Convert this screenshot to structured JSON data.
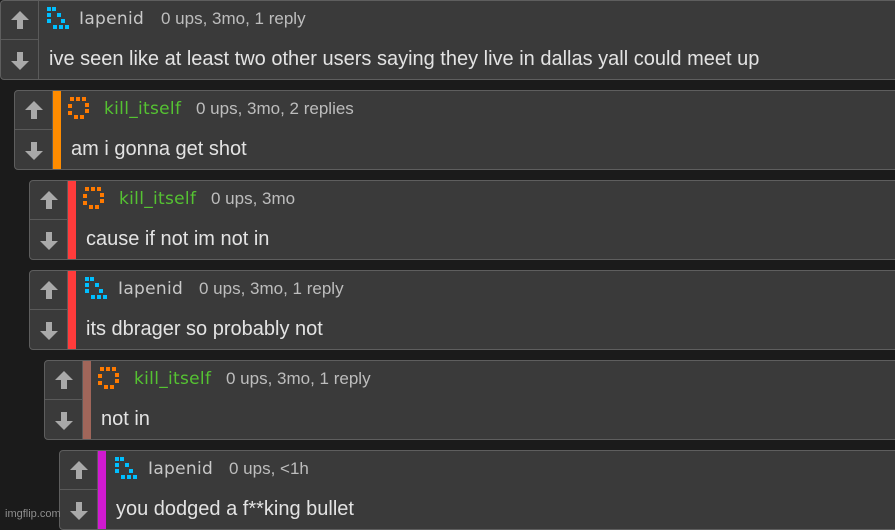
{
  "colors": {
    "user_blue": "#00bfff",
    "user_orange": "#ff7a00",
    "username_gray": "#c8c8c8",
    "username_green": "#55c232",
    "depth_bars": [
      "#ff8c00",
      "#ff3b3b",
      "#ff3b3b",
      "#a0665a",
      "#d11ad1"
    ]
  },
  "comments": [
    {
      "username": "Iapenid",
      "meta": "0 ups, 3mo, 1 reply",
      "text": "ive seen like at least two other users saying they live in dallas yall could meet up",
      "avatar_icon": "blue-pixel-avatar-icon"
    },
    {
      "username": "kill_itself",
      "meta": "0 ups, 3mo, 2 replies",
      "text": "am i gonna get shot",
      "avatar_icon": "orange-pixel-avatar-icon"
    },
    {
      "username": "kill_itself",
      "meta": "0 ups, 3mo",
      "text": "cause if not im not in",
      "avatar_icon": "orange-pixel-avatar-icon"
    },
    {
      "username": "Iapenid",
      "meta": "0 ups, 3mo, 1 reply",
      "text": "its dbrager so probably not",
      "avatar_icon": "blue-pixel-avatar-icon"
    },
    {
      "username": "kill_itself",
      "meta": "0 ups, 3mo, 1 reply",
      "text": "not in",
      "avatar_icon": "orange-pixel-avatar-icon"
    },
    {
      "username": "Iapenid",
      "meta": "0 ups, <1h",
      "text": "you dodged a f**king bullet",
      "avatar_icon": "blue-pixel-avatar-icon"
    }
  ],
  "watermark": "imgflip.com"
}
